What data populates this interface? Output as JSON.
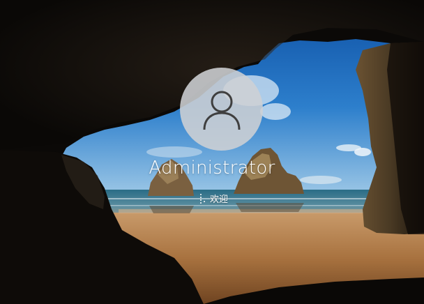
{
  "lock_screen": {
    "account": {
      "name": "Administrator",
      "avatar_icon": "user-silhouette-icon"
    },
    "status": {
      "spinner_icon": "loading-dots-icon",
      "text": "欢迎"
    }
  },
  "colors": {
    "sky": "#1a66b8",
    "sand": "#b98452",
    "sea": "#2e6f8a",
    "avatar_circle": "#ced0d4",
    "text": "#ffffff"
  }
}
